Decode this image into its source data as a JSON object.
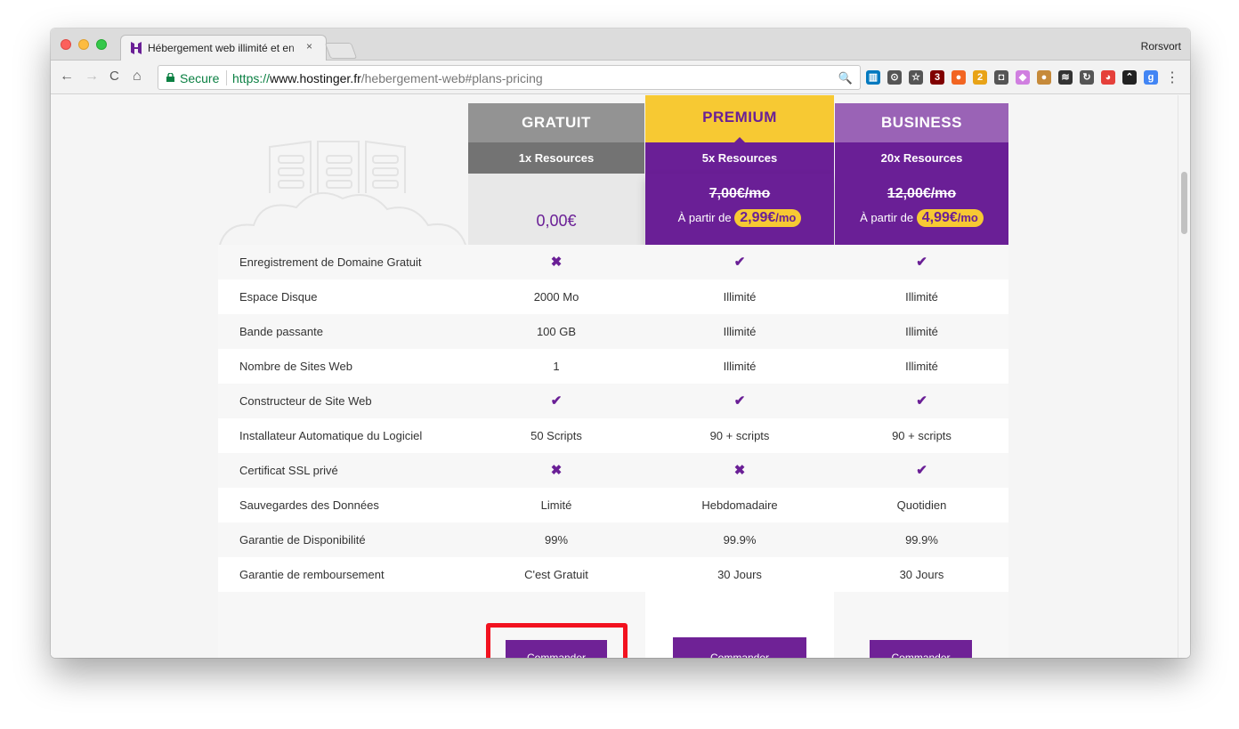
{
  "browser": {
    "tab_title": "Hébergement web illimité et en",
    "tab_close": "×",
    "profile_name": "Rorsvort",
    "back": "←",
    "forward": "→",
    "reload": "C",
    "home": "⌂",
    "secure_label": "Secure",
    "url_scheme": "https://",
    "url_host": "www.hostinger.fr",
    "url_path": "/hebergement-web#plans-pricing",
    "zoom": "🔍",
    "menu": "⋮",
    "extension_icons": [
      {
        "name": "trello-icon",
        "color": "#0079bf",
        "glyph": "▥"
      },
      {
        "name": "arrow-circle-icon",
        "color": "#555555",
        "glyph": "⊙"
      },
      {
        "name": "star-icon",
        "color": "#555555",
        "glyph": "☆"
      },
      {
        "name": "ublock-icon",
        "color": "#800000",
        "glyph": "3"
      },
      {
        "name": "orange-circle-icon",
        "color": "#f26522",
        "glyph": "●"
      },
      {
        "name": "download-icon",
        "color": "#e8a317",
        "glyph": "2"
      },
      {
        "name": "pocket-icon",
        "color": "#555555",
        "glyph": "◘"
      },
      {
        "name": "pink-icon",
        "color": "#d07fe0",
        "glyph": "◆"
      },
      {
        "name": "cookie-icon",
        "color": "#c68a3a",
        "glyph": "●"
      },
      {
        "name": "buffer-icon",
        "color": "#333333",
        "glyph": "≋"
      },
      {
        "name": "refresh-icon",
        "color": "#555555",
        "glyph": "↻"
      },
      {
        "name": "color-icon",
        "color": "#e5403a",
        "glyph": "◕"
      },
      {
        "name": "wave-icon",
        "color": "#222222",
        "glyph": "⌃"
      },
      {
        "name": "google-icon",
        "color": "#4285f4",
        "glyph": "g"
      }
    ]
  },
  "plans": [
    {
      "name": "GRATUIT",
      "resources": "1x Resources",
      "price": "0,00€",
      "old_price": "",
      "from_label": "",
      "promo": "",
      "promo_unit": "",
      "header_color": "#939393",
      "res_color": "#737373",
      "button": "Commander"
    },
    {
      "name": "PREMIUM",
      "resources": "5x Resources",
      "price": "",
      "old_price": "7,00€/mo",
      "from_label": "À partir de",
      "promo": "2,99€",
      "promo_unit": "/mo",
      "header_color": "#f7c933",
      "res_color": "#6a1f96",
      "button": "Commander"
    },
    {
      "name": "BUSINESS",
      "resources": "20x Resources",
      "price": "",
      "old_price": "12,00€/mo",
      "from_label": "À partir de",
      "promo": "4,99€",
      "promo_unit": "/mo",
      "header_color": "#9a63b6",
      "res_color": "#6a1f96",
      "button": "Commander"
    }
  ],
  "features": [
    {
      "label": "Enregistrement de Domaine Gratuit",
      "values": [
        "✖",
        "✔",
        "✔"
      ]
    },
    {
      "label": "Espace Disque",
      "values": [
        "2000 Mo",
        "Illimité",
        "Illimité"
      ]
    },
    {
      "label": "Bande passante",
      "values": [
        "100 GB",
        "Illimité",
        "Illimité"
      ]
    },
    {
      "label": "Nombre de Sites Web",
      "values": [
        "1",
        "Illimité",
        "Illimité"
      ]
    },
    {
      "label": "Constructeur de Site Web",
      "values": [
        "✔",
        "✔",
        "✔"
      ]
    },
    {
      "label": "Installateur Automatique du Logiciel",
      "values": [
        "50 Scripts",
        "90 + scripts",
        "90 + scripts"
      ]
    },
    {
      "label": "Certificat SSL privé",
      "values": [
        "✖",
        "✖",
        "✔"
      ]
    },
    {
      "label": "Sauvegardes des Données",
      "values": [
        "Limité",
        "Hebdomadaire",
        "Quotidien"
      ]
    },
    {
      "label": "Garantie de Disponibilité",
      "values": [
        "99%",
        "99.9%",
        "99.9%"
      ]
    },
    {
      "label": "Garantie de remboursement",
      "values": [
        "C'est Gratuit",
        "30 Jours",
        "30 Jours"
      ]
    }
  ],
  "colors": {
    "accent": "#6a1f96",
    "premium": "#f7c933",
    "highlight": "#f2121f"
  }
}
